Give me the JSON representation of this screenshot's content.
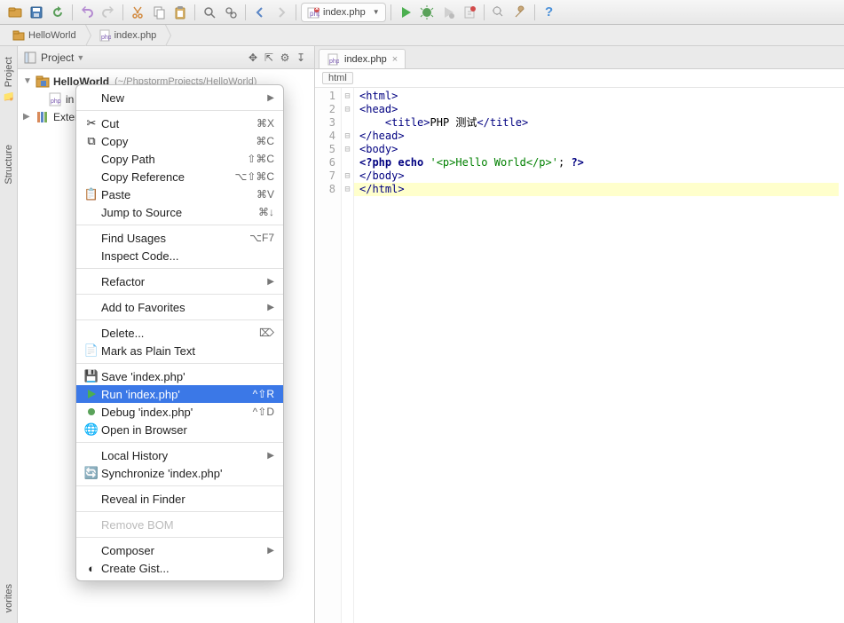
{
  "toolbar": {
    "run_config": "index.php"
  },
  "breadcrumb": {
    "project": "HelloWorld",
    "file": "index.php"
  },
  "project_header": {
    "label": "Project"
  },
  "tree": {
    "root_name": "HelloWorld",
    "root_path": "(~/PhpstormProjects/HelloWorld)",
    "file_partial": "in",
    "libs_partial": "Exter"
  },
  "editor": {
    "tab": "index.php",
    "crumb": "html",
    "lines": [
      "1",
      "2",
      "3",
      "4",
      "5",
      "6",
      "7",
      "8"
    ]
  },
  "code": {
    "l1_open": "<",
    "l1_tag": "html",
    "l1_close": ">",
    "l2_open": "<",
    "l2_tag": "head",
    "l2_close": ">",
    "l3_open": "<",
    "l3_tag": "title",
    "l3_close": ">",
    "l3_text": "PHP 测试",
    "l3_open2": "</",
    "l3_tag2": "title",
    "l3_close2": ">",
    "l4_open": "</",
    "l4_tag": "head",
    "l4_close": ">",
    "l5_open": "<",
    "l5_tag": "body",
    "l5_close": ">",
    "l6_php_open": "<?php ",
    "l6_echo": "echo ",
    "l6_str": "'<p>Hello World</p>'",
    "l6_end": "; ",
    "l6_php_close": "?>",
    "l7_open": "</",
    "l7_tag": "body",
    "l7_close": ">",
    "l8_open": "</",
    "l8_tag": "html",
    "l8_close": ">"
  },
  "context_menu": {
    "new": "New",
    "cut": "Cut",
    "cut_kb": "⌘X",
    "copy": "Copy",
    "copy_kb": "⌘C",
    "copy_path": "Copy Path",
    "copy_path_kb": "⇧⌘C",
    "copy_ref": "Copy Reference",
    "copy_ref_kb": "⌥⇧⌘C",
    "paste": "Paste",
    "paste_kb": "⌘V",
    "jump": "Jump to Source",
    "jump_kb": "⌘↓",
    "find_usages": "Find Usages",
    "find_usages_kb": "⌥F7",
    "inspect": "Inspect Code...",
    "refactor": "Refactor",
    "favorites": "Add to Favorites",
    "delete": "Delete...",
    "delete_kb": "⌦",
    "mark_plain": "Mark as Plain Text",
    "save": "Save 'index.php'",
    "run": "Run 'index.php'",
    "run_kb": "^⇧R",
    "debug": "Debug 'index.php'",
    "debug_kb": "^⇧D",
    "browser": "Open in Browser",
    "local_history": "Local History",
    "sync": "Synchronize 'index.php'",
    "reveal": "Reveal in Finder",
    "remove_bom": "Remove BOM",
    "composer": "Composer",
    "gist": "Create Gist..."
  },
  "side_tabs": {
    "project": "Project",
    "structure": "Structure",
    "favorites": "vorites"
  }
}
